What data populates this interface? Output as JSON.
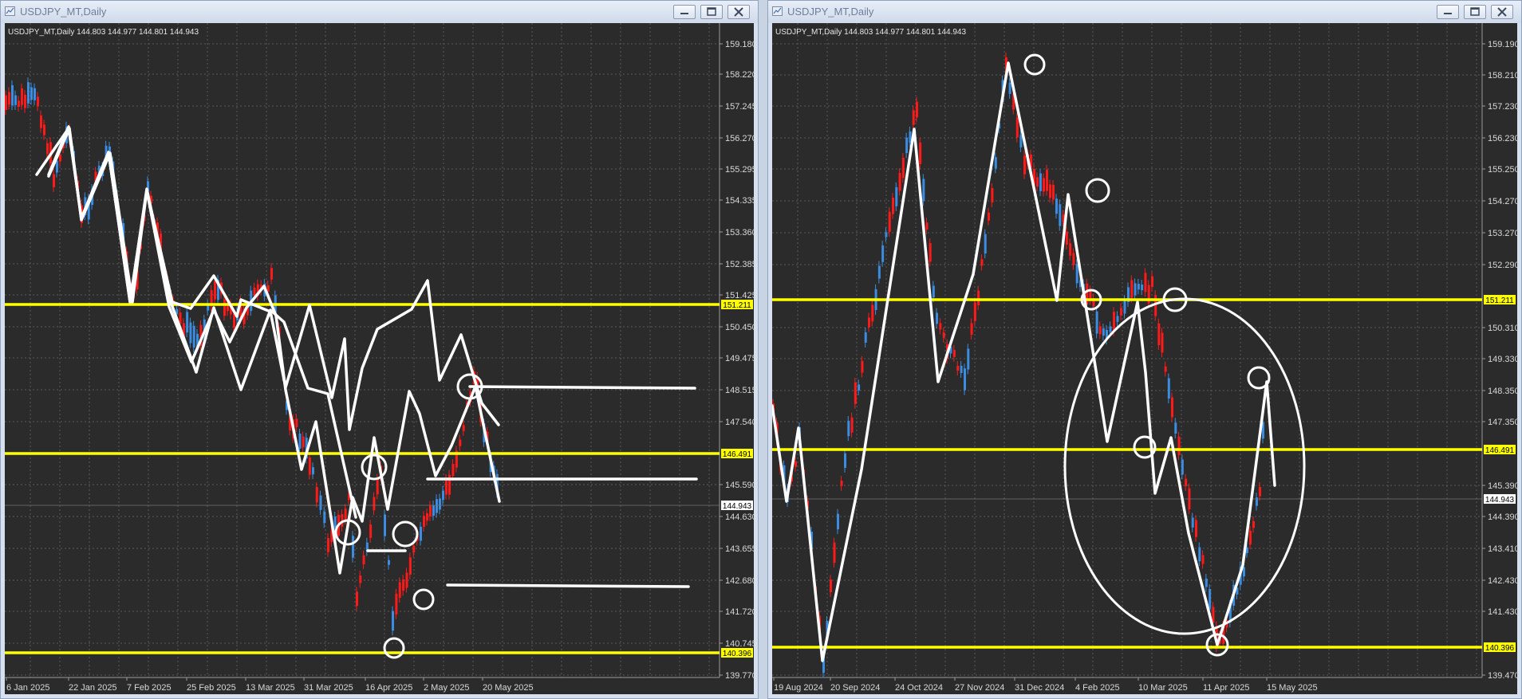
{
  "windows": [
    {
      "title": "USDJPY_MT,Daily",
      "info": "USDJPY_MT,Daily  144.803 144.977 144.801 144.943",
      "price_axis": [
        "159.180",
        "158.220",
        "157.245",
        "156.270",
        "155.295",
        "154.335",
        "153.360",
        "152.385",
        "151.425",
        "150.450",
        "149.475",
        "148.515",
        "147.540",
        "145.590",
        "144.630",
        "143.655",
        "142.680",
        "141.720",
        "140.745",
        "139.770"
      ],
      "date_axis": [
        "6 Jan 2025",
        "22 Jan 2025",
        "7 Feb 2025",
        "25 Feb 2025",
        "13 Mar 2025",
        "31 Mar 2025",
        "16 Apr 2025",
        "2 May 2025",
        "20 May 2025"
      ],
      "levels": [
        {
          "label": "151.211",
          "value": 151.211
        },
        {
          "label": "146.491",
          "value": 146.491
        },
        {
          "label": "140.396",
          "value": 140.396
        }
      ],
      "current": {
        "label": "144.943",
        "value": 144.943
      }
    },
    {
      "title": "USDJPY_MT,Daily",
      "info": "USDJPY_MT,Daily  144.803 144.977 144.801 144.943",
      "price_axis": [
        "159.190",
        "158.210",
        "157.230",
        "156.230",
        "155.250",
        "154.270",
        "153.270",
        "152.290",
        "150.310",
        "149.330",
        "148.350",
        "147.350",
        "145.390",
        "144.390",
        "143.410",
        "142.430",
        "141.430",
        "139.470"
      ],
      "date_axis": [
        "19 Aug 2024",
        "20 Sep 2024",
        "24 Oct 2024",
        "27 Nov 2024",
        "31 Dec 2024",
        "4 Feb 2025",
        "10 Mar 2025",
        "11 Apr 2025",
        "15 May 2025"
      ],
      "levels": [
        {
          "label": "151.211",
          "value": 151.211
        },
        {
          "label": "146.491",
          "value": 146.491
        },
        {
          "label": "140.396",
          "value": 140.396
        }
      ],
      "current": {
        "label": "144.943",
        "value": 144.943
      }
    }
  ],
  "colors": {
    "background": "#2b2b2b",
    "grid": "#5a5a5a",
    "level_line": "#ffff00",
    "bull_candle": "#3a8de0",
    "bear_candle": "#ff1a1a",
    "drawing": "#ffffff",
    "axis_text": "#d8d8d8"
  },
  "icons": [
    "chart-window-icon",
    "minimize-icon",
    "maximize-icon",
    "close-icon"
  ]
}
